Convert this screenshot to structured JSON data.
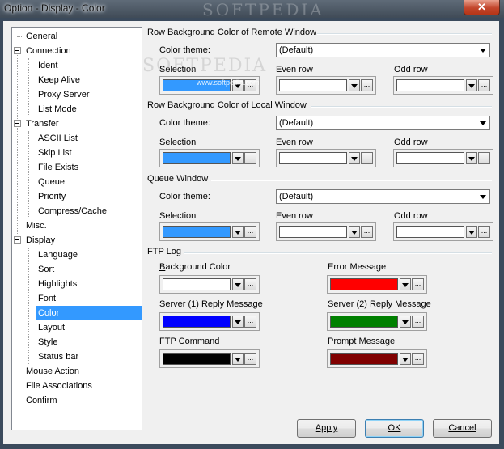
{
  "window": {
    "title": "Option - Display - Color",
    "watermark": "SOFTPEDIA",
    "close_glyph": "✕"
  },
  "tree": {
    "items": [
      {
        "label": "General"
      },
      {
        "label": "Connection"
      },
      {
        "label": "Ident"
      },
      {
        "label": "Keep Alive"
      },
      {
        "label": "Proxy Server"
      },
      {
        "label": "List Mode"
      },
      {
        "label": "Transfer"
      },
      {
        "label": "ASCII List"
      },
      {
        "label": "Skip List"
      },
      {
        "label": "File Exists"
      },
      {
        "label": "Queue"
      },
      {
        "label": "Priority"
      },
      {
        "label": "Compress/Cache"
      },
      {
        "label": "Misc."
      },
      {
        "label": "Display"
      },
      {
        "label": "Language"
      },
      {
        "label": "Sort"
      },
      {
        "label": "Highlights"
      },
      {
        "label": "Font"
      },
      {
        "label": "Color"
      },
      {
        "label": "Layout"
      },
      {
        "label": "Style"
      },
      {
        "label": "Status bar"
      },
      {
        "label": "Mouse Action"
      },
      {
        "label": "File Associations"
      },
      {
        "label": "Confirm"
      }
    ],
    "selected": "Color"
  },
  "remote": {
    "title": "Row Background Color of Remote Window",
    "theme_label": "Color theme:",
    "theme_value": "(Default)",
    "selection_label": "Selection",
    "even_label": "Even row",
    "odd_label": "Odd row",
    "selection_color": "#3399ff",
    "even_color": "#ffffff",
    "odd_color": "#ffffff"
  },
  "local": {
    "title": "Row Background Color of Local Window",
    "theme_label": "Color theme:",
    "theme_value": "(Default)",
    "selection_label": "Selection",
    "even_label": "Even row",
    "odd_label": "Odd row",
    "selection_color": "#3399ff",
    "even_color": "#ffffff",
    "odd_color": "#ffffff"
  },
  "queue": {
    "title": "Queue Window",
    "theme_label": "Color theme:",
    "theme_value": "(Default)",
    "selection_label": "Selection",
    "even_label": "Even row",
    "odd_label": "Odd row",
    "selection_color": "#3399ff",
    "even_color": "#ffffff",
    "odd_color": "#ffffff"
  },
  "ftplog": {
    "title": "FTP Log",
    "bg_label_first": "B",
    "bg_label_rest": "ackground Color",
    "bg_color": "#ffffff",
    "error_label": "Error Message",
    "error_color": "#ff0000",
    "server1_label": "Server (1) Reply Message",
    "server1_color": "#0000ff",
    "server2_label": "Server (2) Reply Message",
    "server2_color": "#008000",
    "command_label": "FTP Command",
    "command_color": "#000000",
    "prompt_label": "Prompt Message",
    "prompt_color": "#800000"
  },
  "buttons": {
    "apply": "Apply",
    "ok": "OK",
    "cancel": "Cancel"
  },
  "more_glyph": "...",
  "watermark_url": "www.softpedia.com"
}
